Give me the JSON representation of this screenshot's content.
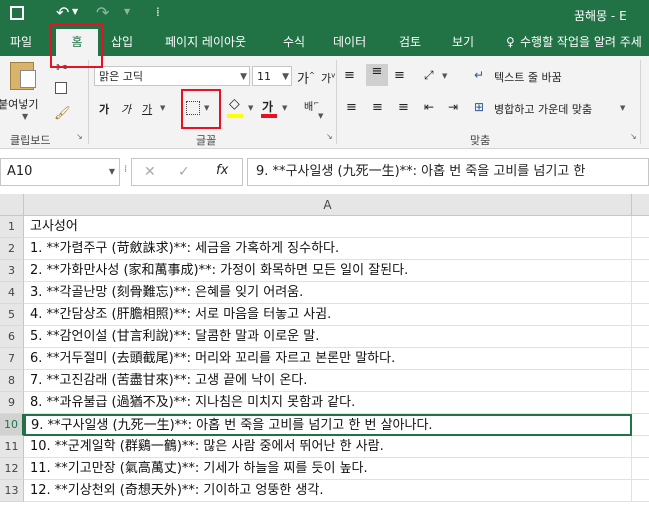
{
  "title_bar": {
    "file_name": "꿈해몽 - E"
  },
  "tabs": [
    "파일",
    "홈",
    "삽입",
    "페이지 레이아웃",
    "수식",
    "데이터",
    "검토",
    "보기"
  ],
  "tell_me": "수행할 작업을 알려 주세",
  "clipboard": {
    "paste_label": "붙여넣기",
    "group_label": "클립보드"
  },
  "font": {
    "font_name": "맑은 고딕",
    "font_size": "11",
    "group_label": "글꼴",
    "bold": "가",
    "italic": "가",
    "underline": "가"
  },
  "alignment": {
    "wrap_text": "텍스트 줄 바꿈",
    "merge_center": "병합하고 가운데 맞춤",
    "group_label": "맞춤"
  },
  "formula_bar": {
    "name_box": "A10",
    "fx": "fx",
    "formula": "9. **구사일생 (九死一生)**: 아홉 번 죽을 고비를 넘기고 한"
  },
  "sheet": {
    "column_header": "A",
    "rows": [
      {
        "num": "1",
        "text": "고사성어"
      },
      {
        "num": "2",
        "text": "1. **가렴주구 (苛斂誅求)**: 세금을 가혹하게 징수하다."
      },
      {
        "num": "3",
        "text": "2. **가화만사성 (家和萬事成)**: 가정이 화목하면 모든 일이 잘된다."
      },
      {
        "num": "4",
        "text": "3. **각골난망 (刻骨難忘)**: 은혜를 잊기 어려움."
      },
      {
        "num": "5",
        "text": "4. **간담상조 (肝膽相照)**: 서로 마음을 터놓고 사귐."
      },
      {
        "num": "6",
        "text": "5. **감언이설 (甘言利說)**: 달콤한 말과 이로운 말."
      },
      {
        "num": "7",
        "text": "6. **거두절미 (去頭截尾)**: 머리와 꼬리를 자르고 본론만 말하다."
      },
      {
        "num": "8",
        "text": "7. **고진감래 (苦盡甘來)**: 고생 끝에 낙이 온다."
      },
      {
        "num": "9",
        "text": "8. **과유불급 (過猶不及)**: 지나침은 미치지 못함과 같다."
      },
      {
        "num": "10",
        "text": "9. **구사일생 (九死一生)**: 아홉 번 죽을 고비를 넘기고 한 번 살아나다."
      },
      {
        "num": "11",
        "text": "10. **군계일학 (群鷄一鶴)**: 많은 사람 중에서 뛰어난 한 사람."
      },
      {
        "num": "12",
        "text": "11. **기고만장 (氣高萬丈)**: 기세가 하늘을 찌를 듯이 높다."
      },
      {
        "num": "13",
        "text": "12. **기상천외 (奇想天外)**: 기이하고 엉뚱한 생각."
      }
    ],
    "selected_row": "10"
  },
  "colors": {
    "accent": "#217346",
    "highlight_box": "#e81123"
  }
}
